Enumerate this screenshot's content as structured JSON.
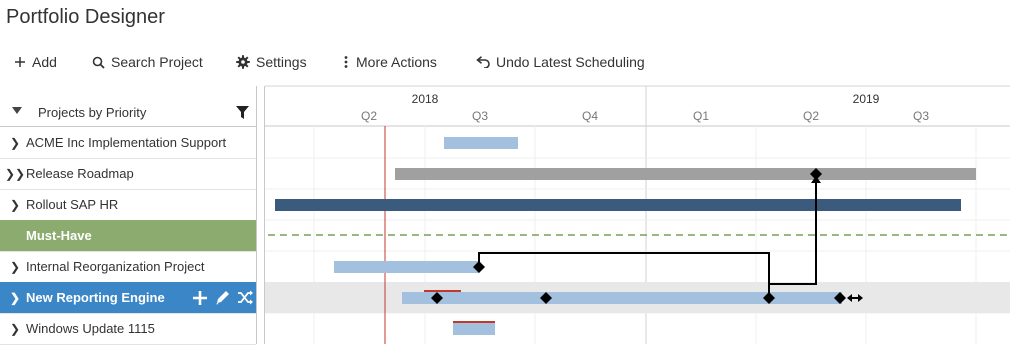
{
  "app": {
    "title": "Portfolio Designer"
  },
  "toolbar": {
    "add": "Add",
    "search": "Search Project",
    "settings": "Settings",
    "more": "More Actions",
    "undo": "Undo Latest Scheduling"
  },
  "grid": {
    "header": "Projects by Priority",
    "rows": [
      {
        "label": "ACME Inc Implementation Support",
        "kind": "project"
      },
      {
        "label": "Release Roadmap",
        "kind": "roadmap"
      },
      {
        "label": "Rollout SAP HR",
        "kind": "project"
      },
      {
        "label": "Must-Have",
        "kind": "group"
      },
      {
        "label": "Internal Reorganization Project",
        "kind": "project"
      },
      {
        "label": "New Reporting Engine",
        "kind": "selected"
      },
      {
        "label": "Windows Update 1115",
        "kind": "project"
      }
    ]
  },
  "timeline": {
    "years": [
      "2018",
      "2019"
    ],
    "quarters": [
      "Q2",
      "Q3",
      "Q4",
      "Q1",
      "Q2",
      "Q3"
    ]
  },
  "colors": {
    "bar_light": "#a3c0df",
    "bar_gray": "#a0a0a0",
    "bar_dark": "#3a5a7e",
    "group_green": "#8bab6f",
    "selected_blue": "#3b86c6",
    "today_line": "#c0392b"
  }
}
